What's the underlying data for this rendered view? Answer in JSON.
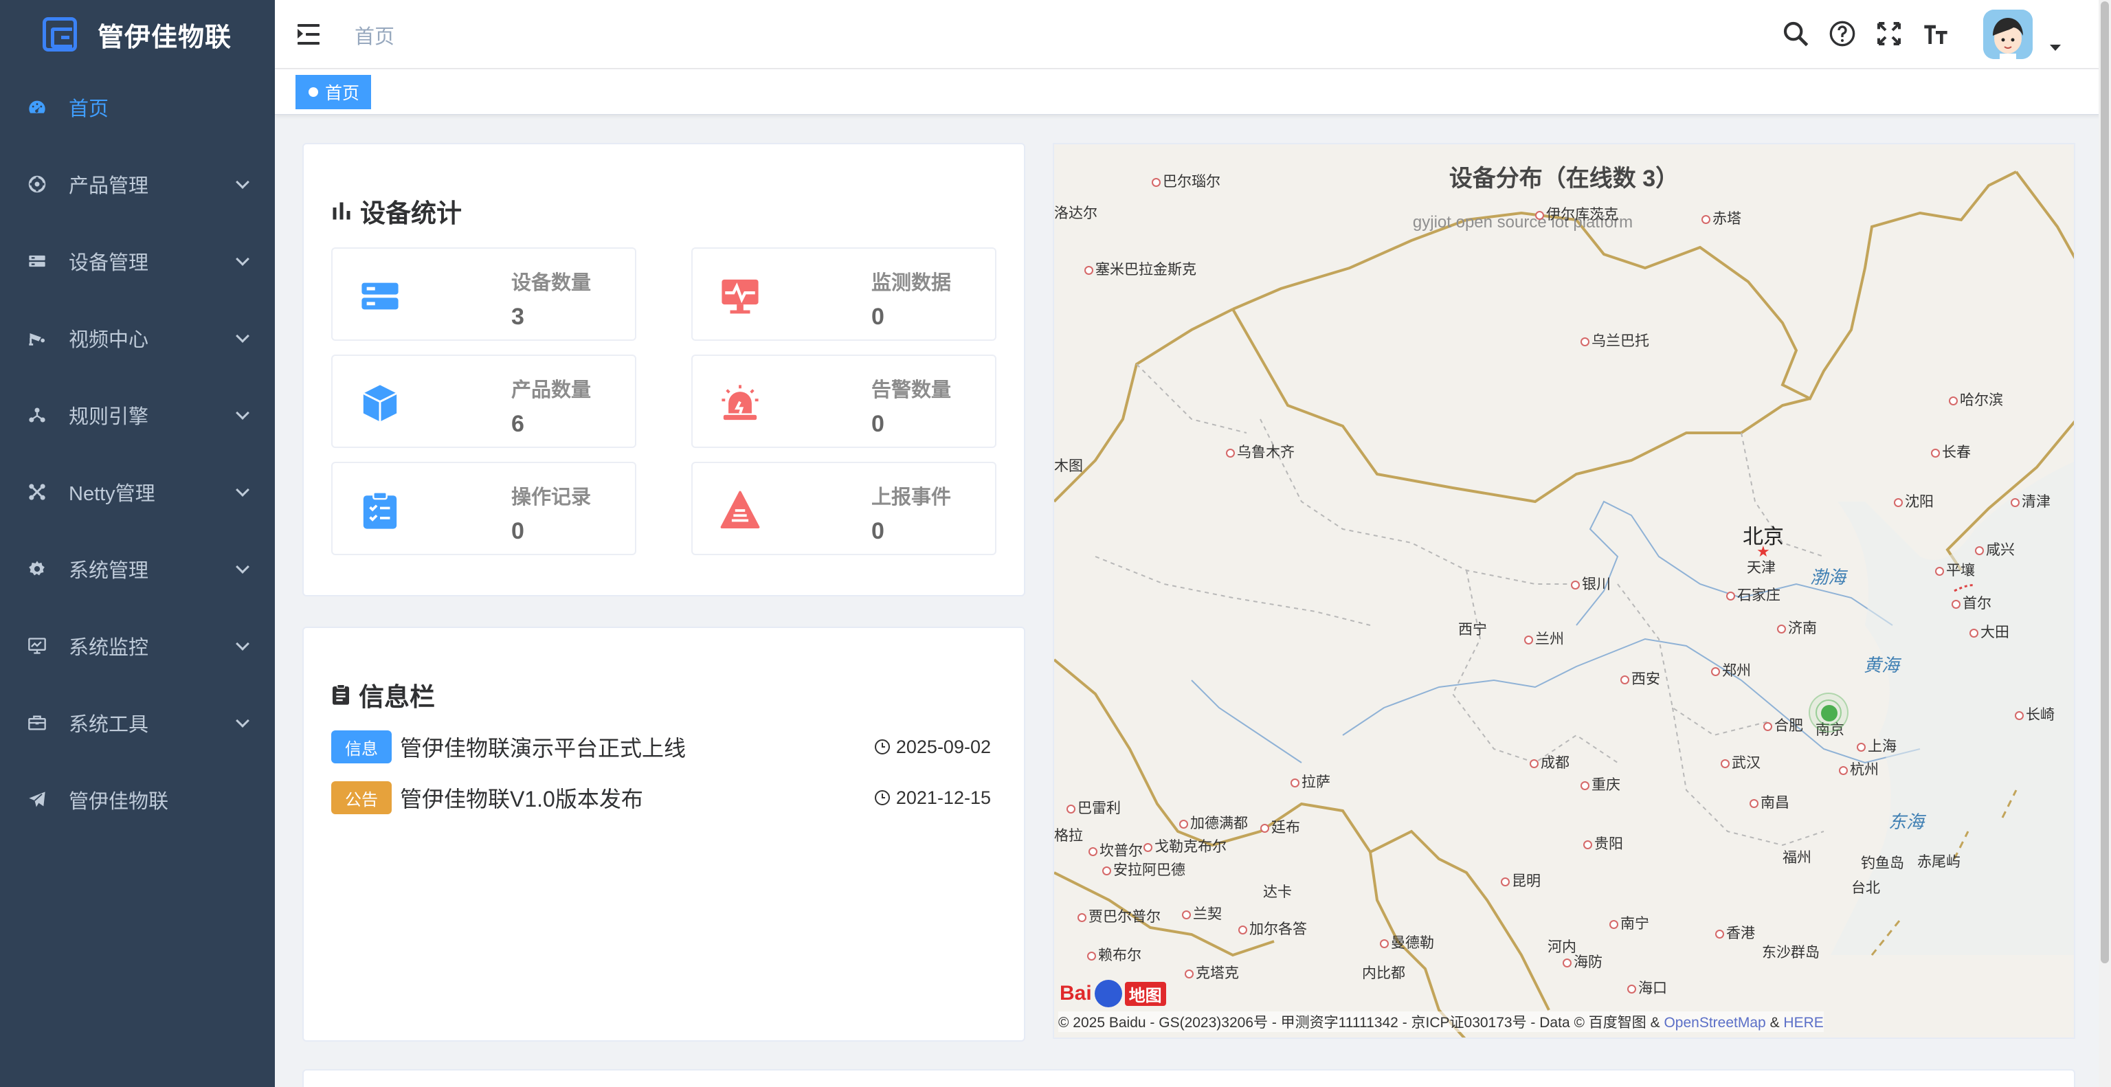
{
  "app": {
    "title": "管伊佳物联"
  },
  "sidebar": {
    "items": [
      {
        "label": "首页",
        "icon": "dashboard-icon"
      },
      {
        "label": "产品管理",
        "icon": "component-icon"
      },
      {
        "label": "设备管理",
        "icon": "server-icon"
      },
      {
        "label": "视频中心",
        "icon": "camera-icon"
      },
      {
        "label": "规则引擎",
        "icon": "tree-icon"
      },
      {
        "label": "Netty管理",
        "icon": "network-icon"
      },
      {
        "label": "系统管理",
        "icon": "gear-icon"
      },
      {
        "label": "系统监控",
        "icon": "monitor-icon"
      },
      {
        "label": "系统工具",
        "icon": "toolbox-icon"
      },
      {
        "label": "管伊佳物联",
        "icon": "send-icon"
      }
    ]
  },
  "navbar": {
    "breadcrumb": "首页"
  },
  "tags": {
    "active": "首页"
  },
  "stats": {
    "title": "设备统计",
    "items": [
      {
        "label": "设备数量",
        "value": "3",
        "icon": "server-stack-icon",
        "color": "#409eff"
      },
      {
        "label": "监测数据",
        "value": "0",
        "icon": "monitor-pulse-icon",
        "color": "#f56c6c"
      },
      {
        "label": "产品数量",
        "value": "6",
        "icon": "cube-icon",
        "color": "#409eff"
      },
      {
        "label": "告警数量",
        "value": "0",
        "icon": "siren-icon",
        "color": "#f56c6c"
      },
      {
        "label": "操作记录",
        "value": "0",
        "icon": "clipboard-icon",
        "color": "#409eff"
      },
      {
        "label": "上报事件",
        "value": "0",
        "icon": "warning-triangle-icon",
        "color": "#f56c6c"
      }
    ]
  },
  "info": {
    "title": "信息栏",
    "items": [
      {
        "tag": "信息",
        "tag_color": "#409eff",
        "title": "管伊佳物联演示平台正式上线",
        "date": "2025-09-02"
      },
      {
        "tag": "公告",
        "tag_color": "#e6a23c",
        "title": "管伊佳物联V1.0版本发布",
        "date": "2021-12-15"
      }
    ]
  },
  "map": {
    "title": "设备分布（在线数 3）",
    "subtitle": "gyjiot open source iot platform",
    "capital": "北京",
    "cities": [
      "巴尔瑙尔",
      "洛达尔",
      "伊尔库茨克",
      "赤塔",
      "塞米巴拉金斯克",
      "乌兰巴托",
      "哈尔滨",
      "长春",
      "乌鲁木齐",
      "木图",
      "沈阳",
      "清津",
      "咸兴",
      "平壤",
      "首尔",
      "大田",
      "天津",
      "银川",
      "石家庄",
      "济南",
      "西宁",
      "兰州",
      "郑州",
      "西安",
      "合肥",
      "南京",
      "上海",
      "长崎",
      "成都",
      "重庆",
      "武汉",
      "杭州",
      "拉萨",
      "南昌",
      "巴雷利",
      "加德满都",
      "廷布",
      "格拉",
      "坎普尔",
      "戈勒克布尔",
      "贵阳",
      "安拉阿巴德",
      "福州",
      "钓鱼岛",
      "赤尾屿",
      "台北",
      "达卡",
      "昆明",
      "兰契",
      "加尔各答",
      "贾巴尔普尔",
      "南宁",
      "香港",
      "赖布尔",
      "曼德勒",
      "河内",
      "海防",
      "东沙群岛",
      "克塔克",
      "内比都",
      "海口"
    ],
    "seas": [
      "渤海",
      "黄海",
      "东海"
    ],
    "copyright_prefix": "© 2025 Baidu - GS(2023)3206号 - 甲测资字11111342 - 京ICP证030173号 - Data © 百度智图 &",
    "copyright_link1": "OpenStreetMap",
    "copyright_amp": "&",
    "copyright_link2": "HERE",
    "logo_text": "Bai",
    "logo_ditu": "地图"
  }
}
